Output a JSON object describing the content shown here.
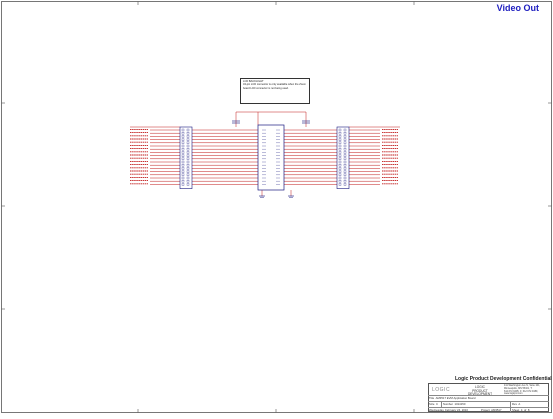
{
  "sheet": {
    "title": "Video Out"
  },
  "note": {
    "header": "LCD BACKLIGHT",
    "body": "34-pin LCD connector is only available when the Zoom board LCD connector is not being used."
  },
  "parts": {
    "left_header": "J4",
    "right_header": "J5",
    "center_connector": "J1",
    "left_cap": "C1",
    "right_cap": "C2"
  },
  "title_block": {
    "confidential": "Logic Product Development Confidential",
    "logo": "LOGIC",
    "company_line1": "LOGIC",
    "company_line2": "PRODUCT DEVELOPMENT",
    "address": "411 Washington Ave N, Suite 101, Minneapolis, MN 55401, T: 612.672.9495, F: 612.672.9489, www.logicpd.com",
    "title_label": "Title",
    "title_value": "AM3517 EVM Application Board",
    "size_label": "Size",
    "size_value": "C",
    "number_label": "Number",
    "number_value": "1014150",
    "rev_label": "Rev",
    "rev_value": "A",
    "date_value": "Wednesday, February 24, 2010",
    "project_label": "Project",
    "project_value": "AM3517",
    "sheet_label": "Sheet",
    "sheet_value": "4",
    "of_label": "of",
    "of_value": "8"
  },
  "colors": {
    "wire": "#c01818",
    "component": "#1a1a80",
    "title": "#2020c0",
    "border": "#333333"
  }
}
